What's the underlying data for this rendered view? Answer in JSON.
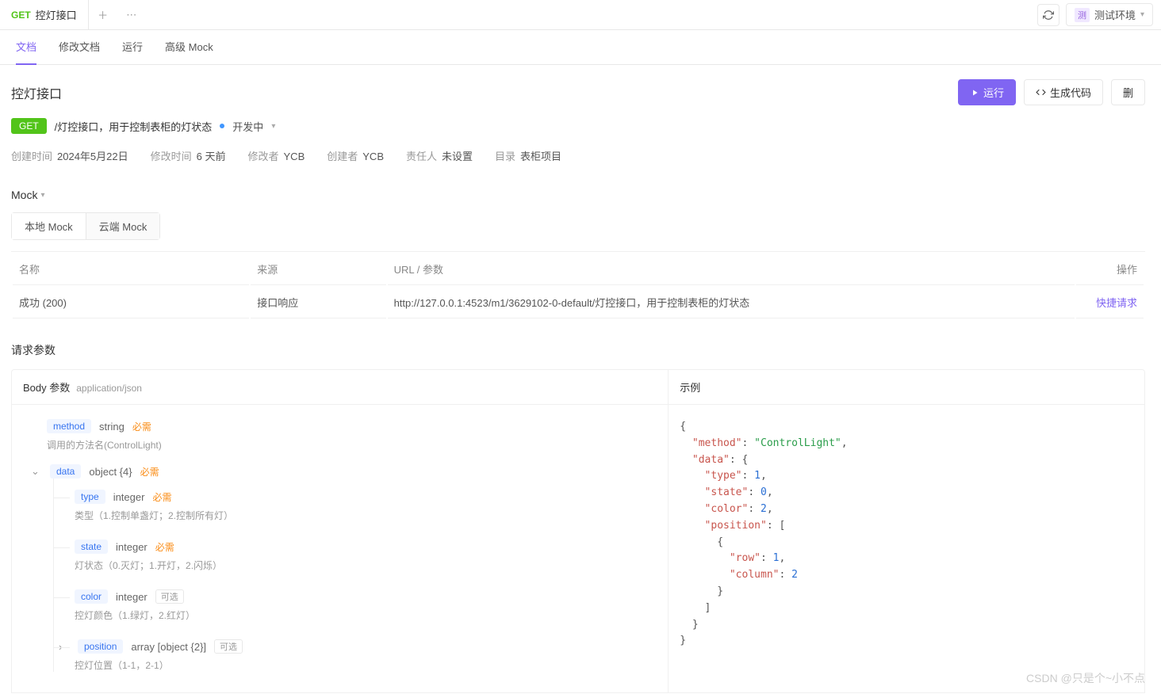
{
  "tab": {
    "method": "GET",
    "title": "控灯接口"
  },
  "env": {
    "badge": "测",
    "label": "测试环境"
  },
  "mainTabs": [
    "文档",
    "修改文档",
    "运行",
    "高级 Mock"
  ],
  "page": {
    "title": "控灯接口"
  },
  "actions": {
    "run": "运行",
    "code": "生成代码",
    "delete": "删"
  },
  "api": {
    "method": "GET",
    "path": "/灯控接口，用于控制表柜的灯状态",
    "status": "开发中"
  },
  "meta": {
    "createdLabel": "创建时间",
    "created": "2024年5月22日",
    "modifiedLabel": "修改时间",
    "modified": "6 天前",
    "modifierLabel": "修改者",
    "modifier": "YCB",
    "creatorLabel": "创建者",
    "creator": "YCB",
    "ownerLabel": "责任人",
    "owner": "未设置",
    "dirLabel": "目录",
    "dir": "表柜项目"
  },
  "mock": {
    "title": "Mock",
    "tabs": [
      "本地 Mock",
      "云端 Mock"
    ],
    "headers": {
      "name": "名称",
      "source": "来源",
      "url": "URL / 参数",
      "op": "操作"
    },
    "row": {
      "name": "成功 (200)",
      "source": "接口响应",
      "url": "http://127.0.0.1:4523/m1/3629102-0-default/灯控接口，用于控制表柜的灯状态",
      "op": "快捷请求"
    }
  },
  "req": {
    "title": "请求参数",
    "bodyLabel": "Body 参数",
    "contentType": "application/json",
    "example": "示例"
  },
  "labels": {
    "required": "必需",
    "optional": "可选"
  },
  "schema": {
    "method": {
      "name": "method",
      "type": "string",
      "desc": "调用的方法名(ControlLight)"
    },
    "data": {
      "name": "data",
      "type": "object {4}",
      "type_field": {
        "name": "type",
        "type": "integer",
        "desc": "类型（1.控制单盏灯；2.控制所有灯）"
      },
      "state": {
        "name": "state",
        "type": "integer",
        "desc": "灯状态（0.灭灯；1.开灯，2.闪烁）"
      },
      "color": {
        "name": "color",
        "type": "integer",
        "desc": "控灯颜色（1.绿灯，2.红灯）"
      },
      "position": {
        "name": "position",
        "type": "array [object {2}]",
        "desc": "控灯位置（1-1，2-1）"
      }
    }
  },
  "exampleJson": {
    "method": "ControlLight",
    "data": {
      "type": 1,
      "state": 0,
      "color": 2,
      "position": [
        {
          "row": 1,
          "column": 2
        }
      ]
    }
  },
  "watermark": "CSDN @只是个~小不点"
}
